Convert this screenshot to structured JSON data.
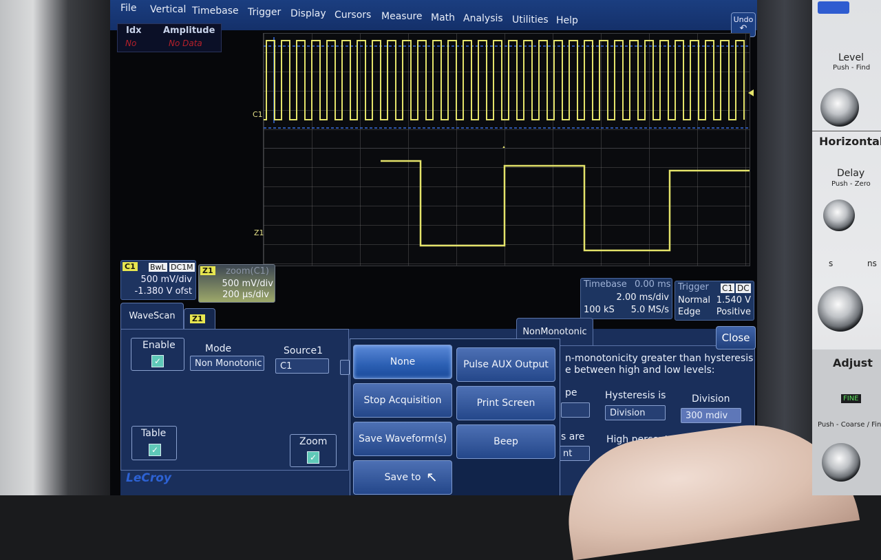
{
  "menu": {
    "items": [
      "File",
      "Vertical",
      "Timebase",
      "Trigger",
      "Display",
      "Cursors",
      "Measure",
      "Math",
      "Analysis",
      "Utilities",
      "Help"
    ],
    "undo_label": "Undo",
    "undo_icon": "undo-arrow-icon"
  },
  "measure_table": {
    "col_idx": "Idx",
    "col_amplitude": "Amplitude",
    "idx_value": "No",
    "amplitude_value": "No Data"
  },
  "traces": {
    "c1_marker": "C1",
    "z1_marker": "Z1"
  },
  "c1_descriptor": {
    "tag": "C1",
    "bw": "BwL",
    "coupling": "DC1M",
    "scale": "500 mV/div",
    "offset": "-1.380 V ofst"
  },
  "z1_descriptor": {
    "tag": "Z1",
    "title": "zoom(C1)",
    "scale": "500 mV/div",
    "time": "200 µs/div"
  },
  "timebase": {
    "label": "Timebase",
    "delay": "0.00 ms",
    "per_div": "2.00 ms/div",
    "samples": "100 kS",
    "rate": "5.0 MS/s"
  },
  "trigger": {
    "label": "Trigger",
    "channel": "C1",
    "coupling": "DC",
    "mode": "Normal",
    "level": "1.540 V",
    "type": "Edge",
    "slope": "Positive"
  },
  "dialog": {
    "tab_wavescan": "WaveScan",
    "tab_z1": "Z1",
    "tab_nonmono": "NonMonotonic",
    "close_label": "Close",
    "enable_label": "Enable",
    "mode_label": "Mode",
    "mode_value": "Non Monotonic",
    "source_label": "Source1",
    "source_value": "C1",
    "table_label": "Table",
    "zoom_label": "Zoom",
    "desc_line1": "n-monotonicity greater than hysteresis",
    "desc_line2": "e between high and low levels:",
    "slope_partial": "pe",
    "hysteresis_label": "Hysteresis is",
    "hysteresis_value": "Division",
    "division_label": "Division",
    "division_value": "300 mdiv",
    "levels_partial": "s are",
    "levels_value_partial": "nt",
    "high_percent_label": "High percent"
  },
  "actions": {
    "none": "None",
    "pulse_aux": "Pulse AUX Output",
    "stop_acq": "Stop Acquisition",
    "print_screen": "Print Screen",
    "save_waveform": "Save Waveform(s)",
    "beep": "Beep",
    "save_labnotebook": "Save to LabNotebook"
  },
  "brand": "LeCroy",
  "hardware": {
    "level": "Level",
    "level_sub": "Push - Find",
    "horizontal": "Horizontal",
    "delay": "Delay",
    "delay_sub": "Push - Zero",
    "s": "s",
    "ns": "ns",
    "adjust": "Adjust",
    "fine": "FINE",
    "coarse": "Push - Coarse / Fine"
  }
}
